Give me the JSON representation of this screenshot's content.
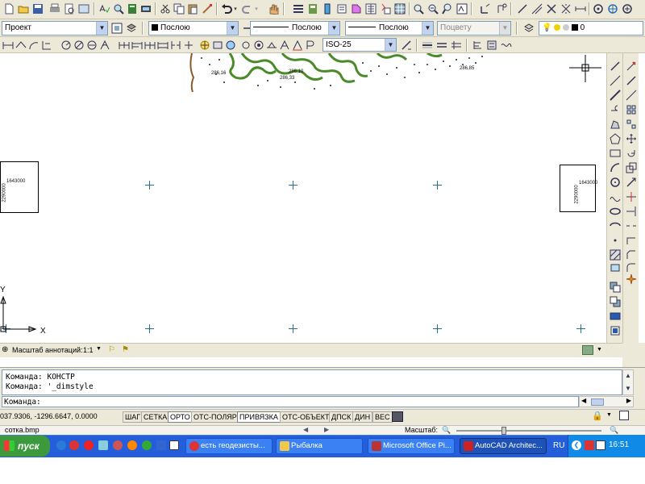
{
  "toolbar1": {
    "icons": [
      "new-icon",
      "open-icon",
      "save-icon",
      "print-icon",
      "preview-icon",
      "publish-icon",
      "spell-icon",
      "find-icon",
      "calc-icon",
      "plot-icon",
      "cut-icon",
      "copy-icon",
      "paste-icon",
      "matchprop-icon",
      "undo-icon",
      "redo-icon",
      "pan-icon",
      "zoom-window-icon",
      "properties-icon",
      "designcenter-icon",
      "toolpalette-icon",
      "sheetset-icon",
      "markup-icon",
      "quickcalc-icon",
      "zoom-realtime-icon",
      "zoom-prev-icon",
      "zoom-extents-icon",
      "layer-on-icon",
      "layer-freeze-icon",
      "layer-lock-icon",
      "layer-color-icon",
      "layer-icon",
      "ucs-icon",
      "ucs-world-icon",
      "close-icon",
      "cross-icon",
      "orbit-icon",
      "orbit-free-icon",
      "target-icon"
    ]
  },
  "toolbar2": {
    "workspace": "Проект",
    "layer": "0",
    "color": "Послою",
    "linetype": "Послою",
    "lineweight": "Послою",
    "plotstyle": "Поцвету"
  },
  "toolbar3": {
    "dimstyle": "ISO-25"
  },
  "drawing": {
    "labels": {
      "elev1": "286,16",
      "elev2": "286,10",
      "elev3": "286,33",
      "elev4": "286,85",
      "left_box_top": "1643000",
      "left_box_side": "2290000",
      "right_box_top": "1643000",
      "right_box_side": "2290000"
    },
    "ucs": {
      "x": "X",
      "y": "Y"
    }
  },
  "annotation_bar": {
    "label": "Масштаб аннотаций:",
    "scale": "1:1"
  },
  "command": {
    "line1": "Команда: КОНСТР",
    "line2": "Команда: '_dimstyle",
    "prompt": "Команда:"
  },
  "status": {
    "coords": "037.9306, -1296.6647, 0.0000",
    "buttons": [
      {
        "label": "ШАГ",
        "on": false
      },
      {
        "label": "СЕТКА",
        "on": false
      },
      {
        "label": "ОРТО",
        "on": true
      },
      {
        "label": "ОТС-ПОЛЯР",
        "on": false
      },
      {
        "label": "ПРИВЯЗКА",
        "on": true
      },
      {
        "label": "ОТС-ОБЪЕКТ",
        "on": false
      },
      {
        "label": "ДПСК",
        "on": false
      },
      {
        "label": "ДИН",
        "on": false
      },
      {
        "label": "ВЕС",
        "on": false
      }
    ]
  },
  "viewer": {
    "filename": "сотка.bmp",
    "zoom_label": "Масштаб:"
  },
  "taskbar": {
    "start": "пуск",
    "tasks": [
      {
        "label": "есть геодезисты...",
        "active": false,
        "color": "#d33"
      },
      {
        "label": "Рыбалка",
        "active": false,
        "color": "#f0c84a"
      },
      {
        "label": "Microsoft Office Pi...",
        "active": false,
        "color": "#b33"
      },
      {
        "label": "AutoCAD Architec...",
        "active": true,
        "color": "#c22"
      }
    ],
    "lang": "RU",
    "time": "16:51"
  },
  "colors": {
    "toolbar_bg": "#ece9d8",
    "taskbar_blue": "#245edb",
    "start_green": "#3c9a3c",
    "tray_blue": "#0f8ae6",
    "contour_green": "#4a8a2a"
  }
}
